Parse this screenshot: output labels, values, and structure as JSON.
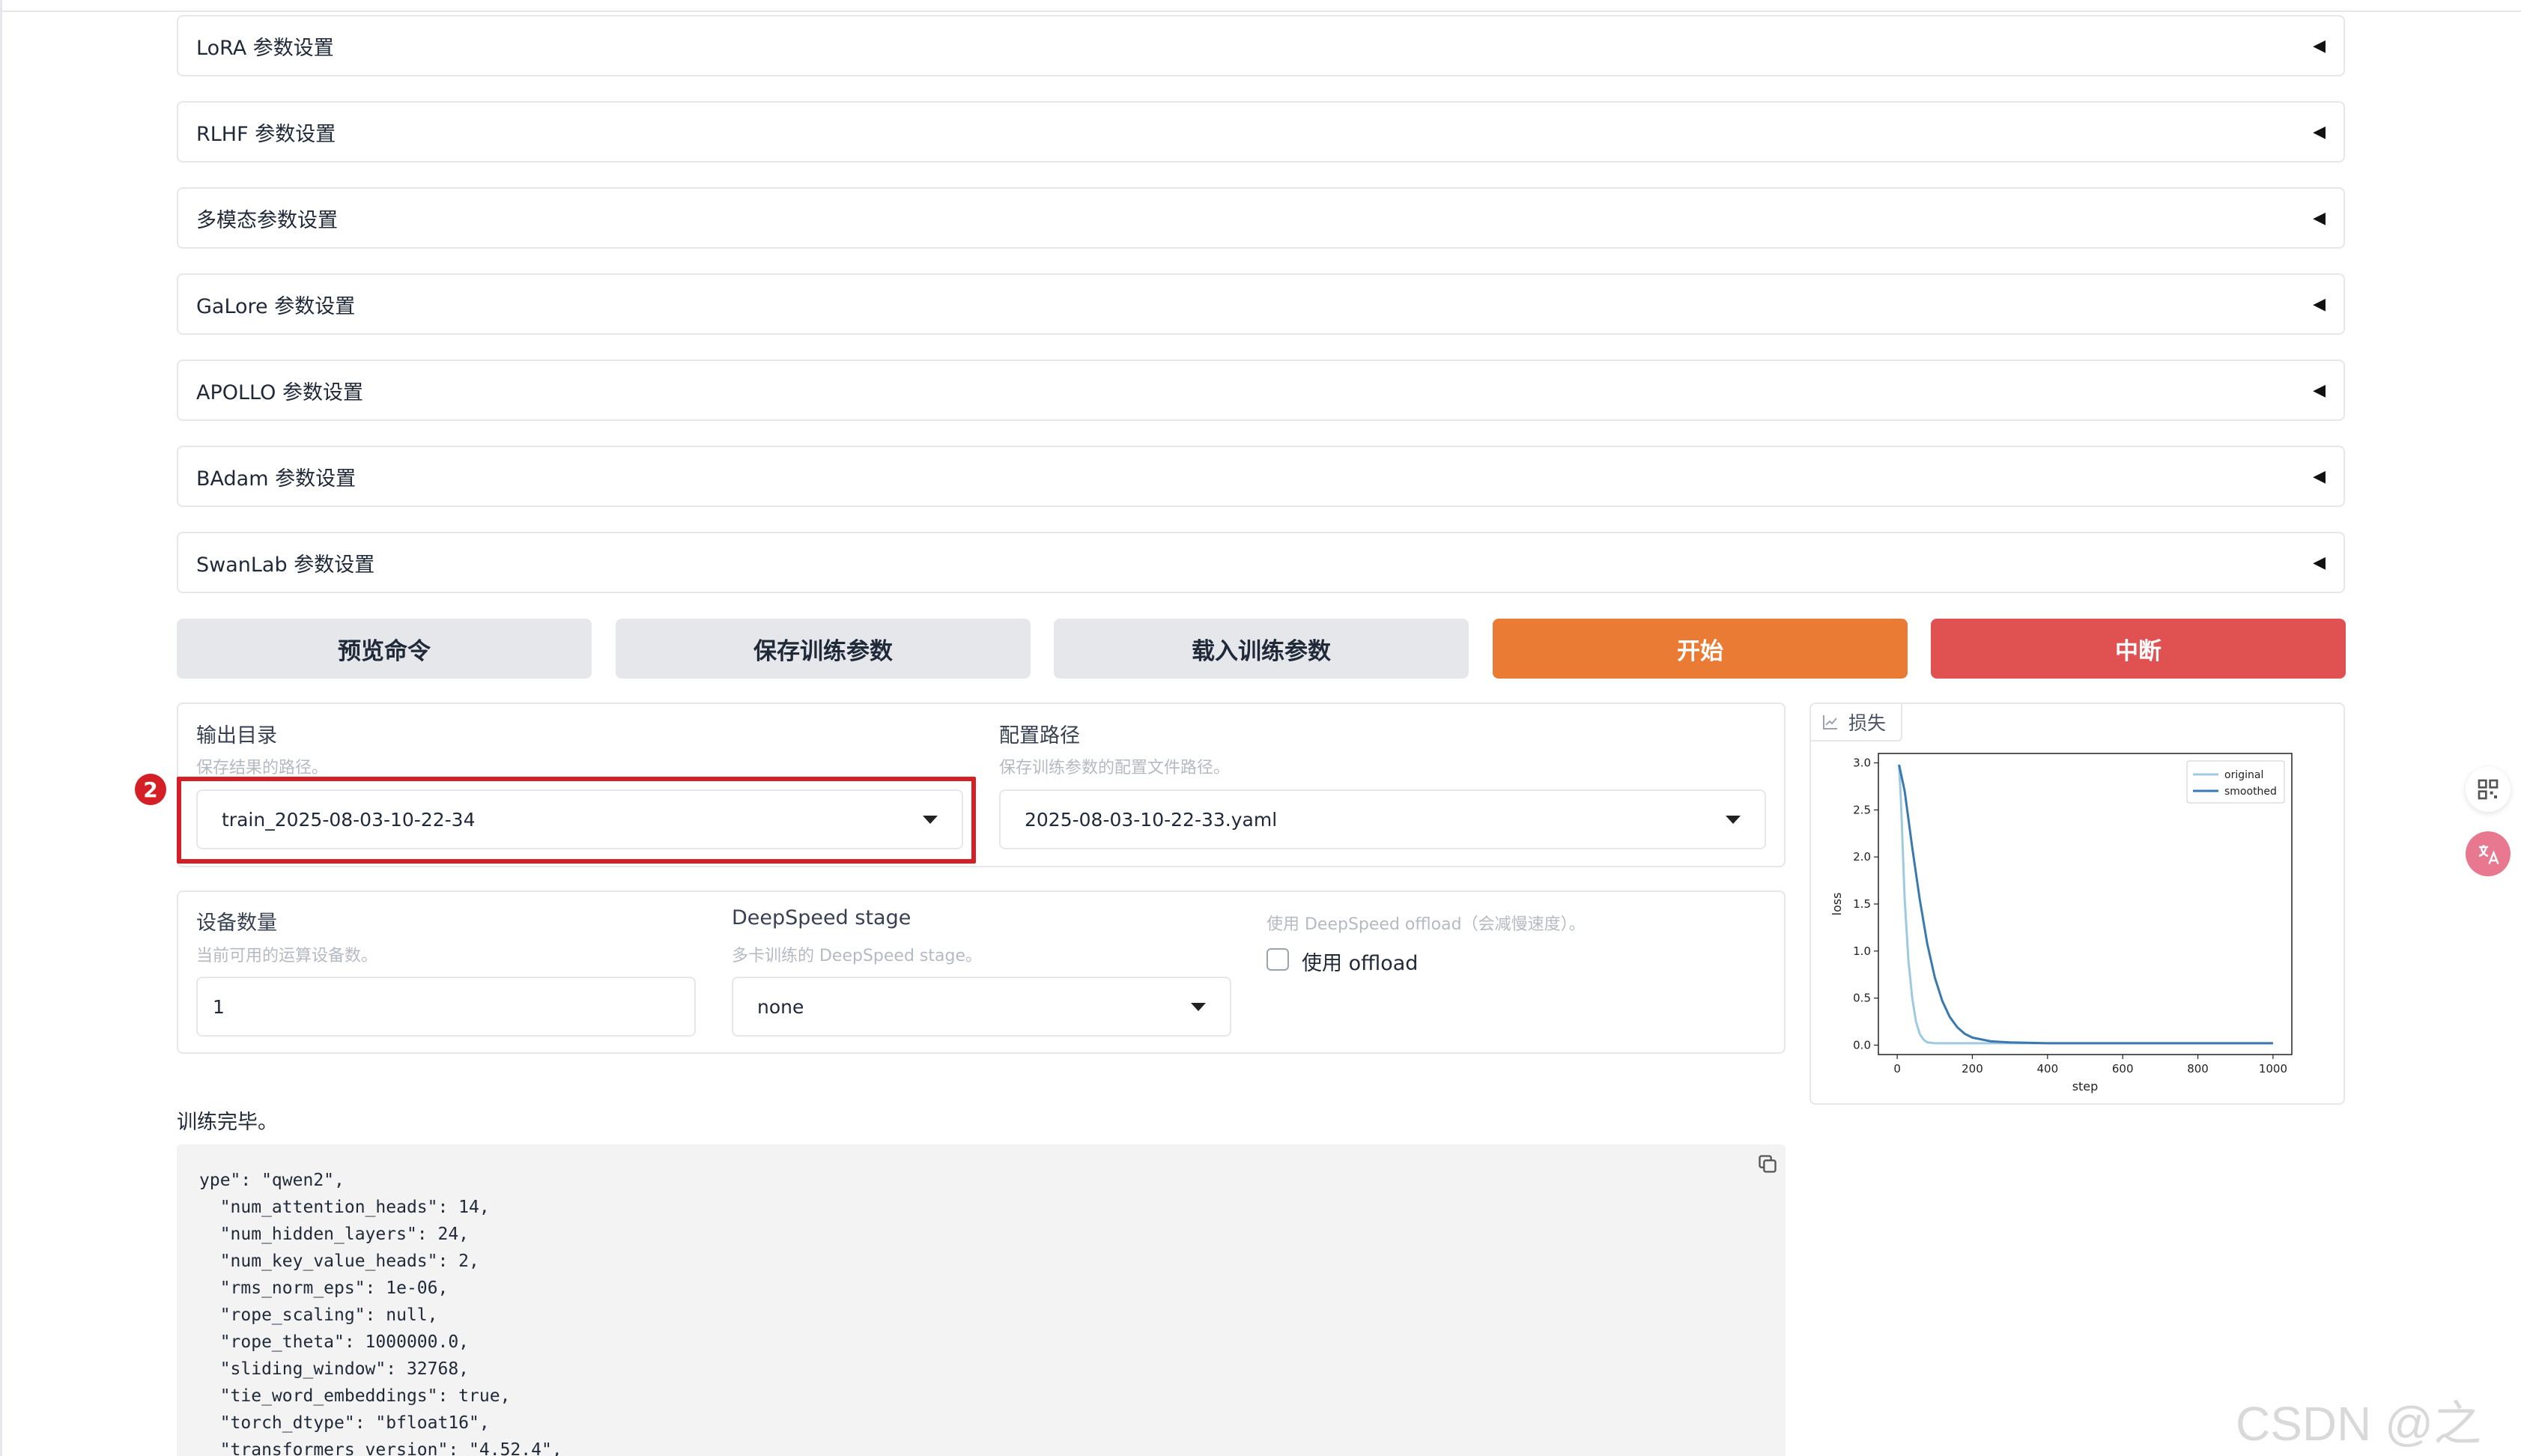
{
  "accordions": [
    {
      "label": "LoRA 参数设置"
    },
    {
      "label": "RLHF 参数设置"
    },
    {
      "label": "多模态参数设置"
    },
    {
      "label": "GaLore 参数设置"
    },
    {
      "label": "APOLLO 参数设置"
    },
    {
      "label": "BAdam 参数设置"
    },
    {
      "label": "SwanLab 参数设置"
    }
  ],
  "accordion_arrow": "◀",
  "actions": {
    "preview": "预览命令",
    "save": "保存训练参数",
    "load": "载入训练参数",
    "start": "开始",
    "abort": "中断"
  },
  "output_dir": {
    "label": "输出目录",
    "info": "保存结果的路径。",
    "value": "train_2025-08-03-10-22-34"
  },
  "config_path": {
    "label": "配置路径",
    "info": "保存训练参数的配置文件路径。",
    "value": "2025-08-03-10-22-33.yaml"
  },
  "annotation_badge": "2",
  "device_count": {
    "label": "设备数量",
    "info": "当前可用的运算设备数。",
    "value": "1"
  },
  "deepspeed_stage": {
    "label": "DeepSpeed stage",
    "info": "多卡训练的 DeepSpeed stage。",
    "value": "none"
  },
  "offload": {
    "info": "使用 DeepSpeed offload（会减慢速度）。",
    "label": "使用 offload",
    "checked": false
  },
  "loss_panel": {
    "title": "损失"
  },
  "chart_data": {
    "type": "line",
    "xlabel": "step",
    "ylabel": "loss",
    "xlim": [
      -50,
      1050
    ],
    "ylim": [
      -0.1,
      3.1
    ],
    "xticks": [
      0,
      200,
      400,
      600,
      800,
      1000
    ],
    "yticks": [
      0.0,
      0.5,
      1.0,
      1.5,
      2.0,
      2.5,
      3.0
    ],
    "legend_position": "top-right",
    "series": [
      {
        "name": "original",
        "color": "#9ecae1",
        "x": [
          5,
          10,
          20,
          30,
          40,
          50,
          60,
          70,
          80,
          100,
          150,
          200,
          400,
          600,
          800,
          1000
        ],
        "y": [
          2.98,
          2.6,
          1.55,
          0.9,
          0.5,
          0.25,
          0.12,
          0.06,
          0.03,
          0.02,
          0.02,
          0.02,
          0.02,
          0.02,
          0.02,
          0.02
        ]
      },
      {
        "name": "smoothed",
        "color": "#3a78b0",
        "x": [
          5,
          20,
          40,
          60,
          80,
          100,
          120,
          140,
          160,
          180,
          200,
          250,
          300,
          400,
          600,
          800,
          1000
        ],
        "y": [
          2.98,
          2.7,
          2.1,
          1.55,
          1.08,
          0.72,
          0.47,
          0.3,
          0.19,
          0.12,
          0.08,
          0.04,
          0.03,
          0.02,
          0.02,
          0.02,
          0.02
        ]
      }
    ]
  },
  "status_text": "训练完毕。",
  "log_lines": [
    "ype\": \"qwen2\",",
    "  \"num_attention_heads\": 14,",
    "  \"num_hidden_layers\": 24,",
    "  \"num_key_value_heads\": 2,",
    "  \"rms_norm_eps\": 1e-06,",
    "  \"rope_scaling\": null,",
    "  \"rope_theta\": 1000000.0,",
    "  \"sliding_window\": 32768,",
    "  \"tie_word_embeddings\": true,",
    "  \"torch_dtype\": \"bfloat16\",",
    "  \"transformers_version\": \"4.52.4\","
  ],
  "watermark": "CSDN @之歆",
  "floating_icons": [
    "qr-grid-icon",
    "translate-icon"
  ],
  "colors": {
    "start": "#ea7b35",
    "abort": "#e05252",
    "highlight": "#d41f26"
  }
}
